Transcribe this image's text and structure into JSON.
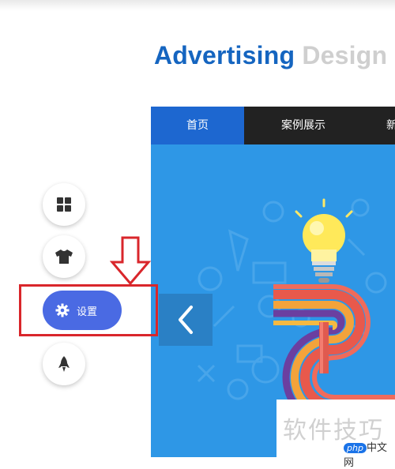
{
  "header": {
    "title_part1": "Advertising",
    "title_part2": "Design"
  },
  "nav": {
    "tabs": [
      {
        "label": "首页"
      },
      {
        "label": "案例展示"
      },
      {
        "label": "新"
      }
    ]
  },
  "sidebar": {
    "buttons": [
      {
        "icon": "grid-icon"
      },
      {
        "icon": "shirt-icon"
      },
      {
        "icon": "gear-icon",
        "label": "设置"
      },
      {
        "icon": "rocket-icon"
      }
    ]
  },
  "banner": {
    "prev_icon": "chevron-left-icon"
  },
  "watermark": {
    "text": "软件技巧",
    "logo_php": "php",
    "logo_site": "中文网"
  },
  "colors": {
    "accent": "#1d67d0",
    "banner_bg": "#2e97e6",
    "settings_btn": "#4a6ae3",
    "highlight": "#d9262b"
  }
}
